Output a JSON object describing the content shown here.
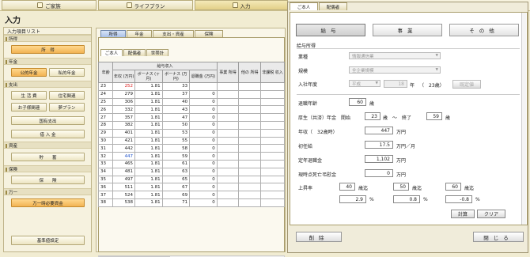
{
  "nav": {
    "tabs": [
      "ご家族",
      "ライフプラン",
      "入力"
    ],
    "active": 2
  },
  "page_title": "入力",
  "sidebar": {
    "heading": "入力項目リスト",
    "sections": {
      "income": "所得",
      "pension": "年金",
      "expense": "支出",
      "assets": "資産",
      "insurance": "保険",
      "emergency": "万一"
    },
    "buttons": {
      "income": "所　得",
      "public_pension": "公的年金",
      "private_pension": "私的年金",
      "living": "生 活 費",
      "housing": "住宅関連",
      "children": "お子様関連",
      "dream": "夢プラン",
      "national": "国有支出",
      "loan": "借 入 金",
      "savings": "貯　　蓄",
      "insurance": "保　　険",
      "emergency_funds": "万一時必要資金",
      "base_settings": "基準値設定"
    }
  },
  "mid": {
    "tabs": [
      "所得",
      "年金",
      "支出・資産",
      "保険"
    ],
    "subtabs": [
      "ご本人",
      "配偶者",
      "世帯計"
    ],
    "table": {
      "h_age": "年齢",
      "h_salary_group": "給与収入",
      "h_annual": "年収 (万円)",
      "h_bonus": "ボーナス (ヶ月)",
      "h_bonus_man": "ボーナス (万円)",
      "h_retire": "退職金 (万円)",
      "h_business": "事業 所得",
      "h_other": "他の 所得",
      "h_nontax": "非課税 収入",
      "rows": [
        [
          "23",
          "252",
          "1.81",
          "33",
          "",
          ""
        ],
        [
          "24",
          "279",
          "1.81",
          "37",
          "0",
          ""
        ],
        [
          "25",
          "306",
          "1.81",
          "40",
          "0",
          ""
        ],
        [
          "26",
          "332",
          "1.81",
          "43",
          "0",
          ""
        ],
        [
          "27",
          "357",
          "1.81",
          "47",
          "0",
          ""
        ],
        [
          "28",
          "382",
          "1.81",
          "50",
          "0",
          ""
        ],
        [
          "29",
          "401",
          "1.81",
          "53",
          "0",
          ""
        ],
        [
          "30",
          "421",
          "1.81",
          "55",
          "0",
          ""
        ],
        [
          "31",
          "442",
          "1.81",
          "58",
          "0",
          ""
        ],
        [
          "32",
          "447",
          "1.81",
          "59",
          "0",
          ""
        ],
        [
          "33",
          "465",
          "1.81",
          "61",
          "0",
          ""
        ],
        [
          "34",
          "481",
          "1.81",
          "63",
          "0",
          ""
        ],
        [
          "35",
          "497",
          "1.81",
          "65",
          "0",
          ""
        ],
        [
          "36",
          "511",
          "1.81",
          "67",
          "0",
          ""
        ],
        [
          "37",
          "524",
          "1.81",
          "69",
          "0",
          ""
        ],
        [
          "38",
          "538",
          "1.81",
          "71",
          "0",
          ""
        ]
      ]
    }
  },
  "dialog": {
    "tabs": [
      "ご本人",
      "配偶者"
    ],
    "big_tabs": [
      "給与",
      "事業",
      "その他"
    ],
    "group_title": "給与所得",
    "industry_label": "業種",
    "industry_value": "情報通信業",
    "size_label": "規模",
    "size_value": "全企業規模",
    "join_label": "入社年度",
    "join_era": "平成",
    "join_year": "18",
    "join_unit": "年",
    "join_age": "（　23歳）",
    "join_std_btn": "既定値",
    "retire_age_label": "退職年齢",
    "retire_age": "60",
    "age_unit": "歳",
    "pension_label": "厚生（共済）年金　開始",
    "pension_start": "23",
    "pension_mid": "歳　～　終了",
    "pension_end": "59",
    "pension_unit": "歳",
    "annual_label": "年収（　32歳時）",
    "annual_value": "447",
    "annual_unit": "万円",
    "starting_label": "初任給",
    "starting_value": "17.5",
    "starting_unit": "万円／月",
    "retire_pay_label": "定年退職金",
    "retire_pay_value": "1,102",
    "retire_pay_unit": "万円",
    "death_pay_label": "現時点死亡弔慰金",
    "death_pay_value": "0",
    "death_pay_unit": "万円",
    "raise_label": "上昇率",
    "raise_ages": [
      "40",
      "50",
      "60"
    ],
    "raise_age_unit": "歳迄",
    "raise_rates": [
      "2.9",
      "0.8",
      "-0.8"
    ],
    "rate_unit": "%",
    "calc_btn": "計算",
    "clear_btn": "クリア",
    "delete_btn": "削除",
    "close_btn": "閉じる"
  }
}
